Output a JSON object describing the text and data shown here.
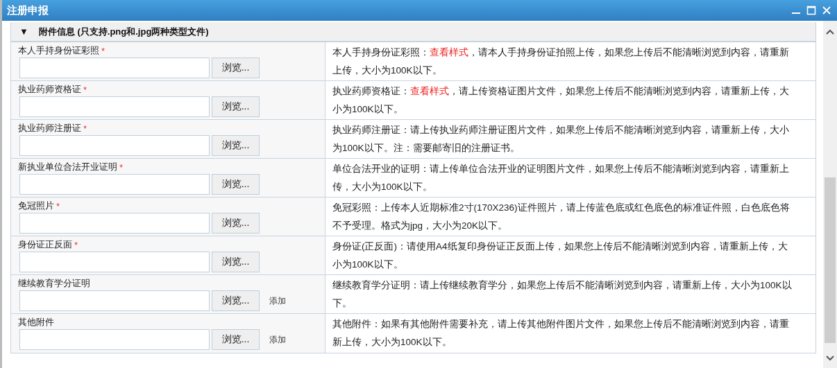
{
  "window": {
    "title": "注册申报"
  },
  "section": {
    "toggle": "▼",
    "title": "附件信息 (只支持.png和.jpg两种类型文件)",
    "expanded": true
  },
  "rows": [
    {
      "label": "本人手持身份证彩照",
      "mark": "*",
      "browse": "浏览...",
      "add": null,
      "desc_before": "本人手持身份证彩照：",
      "link": "查看样式",
      "desc_after": "，请本人手持身份证拍照上传，如果您上传后不能清晰浏览到内容，请重新上传，大小为100K以下。"
    },
    {
      "label": "执业药师资格证",
      "mark": "*",
      "browse": "浏览...",
      "add": null,
      "desc_before": "执业药师资格证：",
      "link": "查看样式",
      "desc_after": "，请上传资格证图片文件，如果您上传后不能清晰浏览到内容，请重新上传，大小为100K以下。"
    },
    {
      "label": "执业药师注册证",
      "mark": "*",
      "browse": "浏览...",
      "add": null,
      "desc_before": "执业药师注册证：请上传执业药师注册证图片文件，如果您上传后不能清晰浏览到内容，请重新上传，大小为100K以下。注：需要邮寄旧的注册证书。",
      "link": null,
      "desc_after": null
    },
    {
      "label": "新执业单位合法开业证明",
      "mark": "*",
      "browse": "浏览...",
      "add": null,
      "desc_before": "单位合法开业的证明：请上传单位合法开业的证明图片文件，如果您上传后不能清晰浏览到内容，请重新上传，大小为100K以下。",
      "link": null,
      "desc_after": null
    },
    {
      "label": "免冠照片",
      "mark": "*",
      "browse": "浏览...",
      "add": null,
      "desc_before": "免冠彩照：上传本人近期标准2寸(170X236)证件照片，请上传蓝色底或红色底色的标准证件照，白色底色将不予受理。格式为jpg，大小为20K以下。",
      "link": null,
      "desc_after": null
    },
    {
      "label": "身份证正反面",
      "mark": "*",
      "browse": "浏览...",
      "add": null,
      "desc_before": "身份证(正反面)：请使用A4纸复印身份证正反面上传，如果您上传后不能清晰浏览到内容，请重新上传，大小为100K以下。",
      "link": null,
      "desc_after": null
    },
    {
      "label": "继续教育学分证明",
      "browse": "浏览...",
      "add": "添加",
      "desc_before": "继续教育学分证明：请上传继续教育学分，如果您上传后不能清晰浏览到内容，请重新上传，大小为100K以下。",
      "link": null,
      "desc_after": null
    },
    {
      "label": "其他附件",
      "browse": "浏览...",
      "add": "添加",
      "desc_before": "其他附件：如果有其他附件需要补充，请上传其他附件图片文件，如果您上传后不能清晰浏览到内容，请重新上传，大小为100K以下。",
      "link": null,
      "desc_after": null
    }
  ]
}
